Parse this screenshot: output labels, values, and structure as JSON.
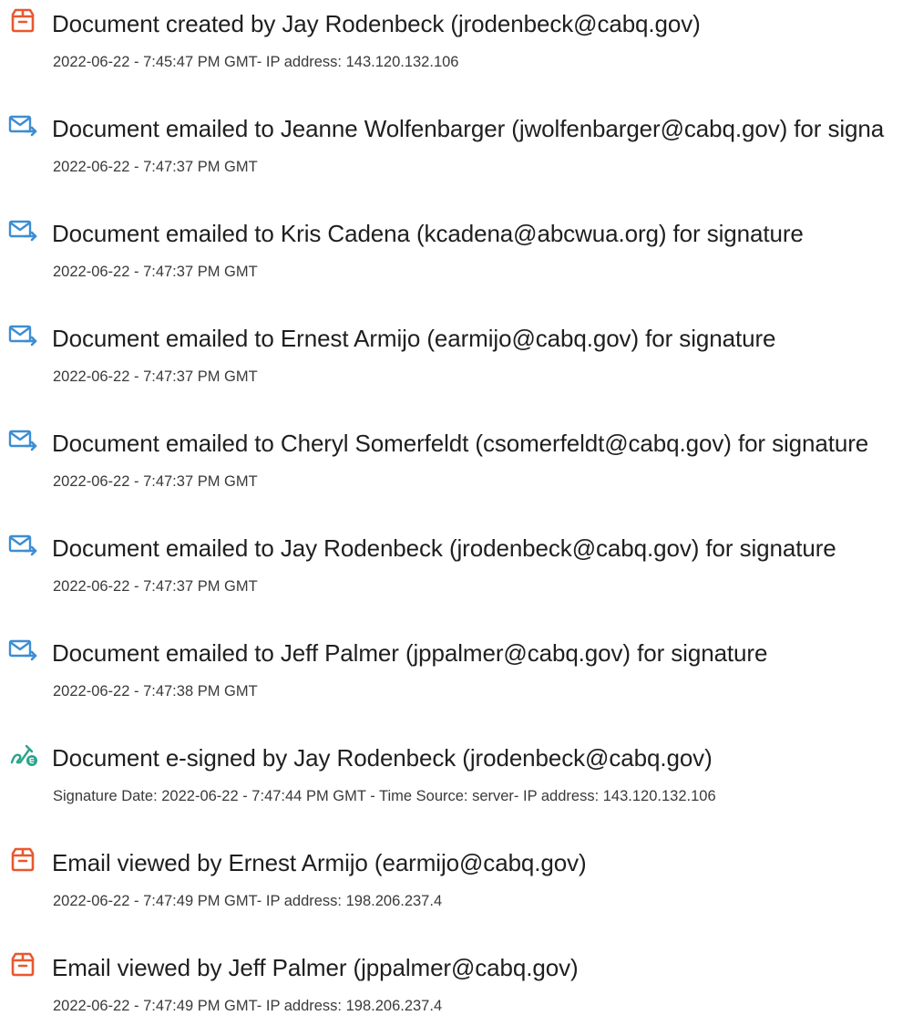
{
  "colors": {
    "created_icon": "#e8582e",
    "email_icon": "#3c8ed3",
    "signed_icon": "#2aa48c",
    "text": "#1f1f1f"
  },
  "events": [
    {
      "icon": "document-created-icon",
      "title": "Document created by Jay Rodenbeck (jrodenbeck@cabq.gov)",
      "detail": "2022-06-22 - 7:45:47 PM GMT- IP address: 143.120.132.106"
    },
    {
      "icon": "email-sent-icon",
      "title": "Document emailed to Jeanne Wolfenbarger (jwolfenbarger@cabq.gov) for signa",
      "detail": "2022-06-22 - 7:47:37 PM GMT"
    },
    {
      "icon": "email-sent-icon",
      "title": "Document emailed to Kris Cadena (kcadena@abcwua.org) for signature",
      "detail": "2022-06-22 - 7:47:37 PM GMT"
    },
    {
      "icon": "email-sent-icon",
      "title": "Document emailed to Ernest Armijo (earmijo@cabq.gov) for signature",
      "detail": "2022-06-22 - 7:47:37 PM GMT"
    },
    {
      "icon": "email-sent-icon",
      "title": "Document emailed to Cheryl Somerfeldt (csomerfeldt@cabq.gov) for signature",
      "detail": "2022-06-22 - 7:47:37 PM GMT"
    },
    {
      "icon": "email-sent-icon",
      "title": "Document emailed to Jay Rodenbeck (jrodenbeck@cabq.gov) for signature",
      "detail": "2022-06-22 - 7:47:37 PM GMT"
    },
    {
      "icon": "email-sent-icon",
      "title": "Document emailed to Jeff Palmer (jppalmer@cabq.gov) for signature",
      "detail": "2022-06-22 - 7:47:38 PM GMT"
    },
    {
      "icon": "e-signed-icon",
      "title": "Document e-signed by Jay Rodenbeck (jrodenbeck@cabq.gov)",
      "detail": "Signature Date: 2022-06-22 - 7:47:44 PM GMT - Time Source: server- IP address: 143.120.132.106"
    },
    {
      "icon": "email-viewed-icon",
      "title": "Email viewed by Ernest Armijo (earmijo@cabq.gov)",
      "detail": "2022-06-22 - 7:47:49 PM GMT- IP address: 198.206.237.4"
    },
    {
      "icon": "email-viewed-icon",
      "title": "Email viewed by Jeff Palmer (jppalmer@cabq.gov)",
      "detail": "2022-06-22 - 7:47:49 PM GMT- IP address: 198.206.237.4"
    }
  ]
}
